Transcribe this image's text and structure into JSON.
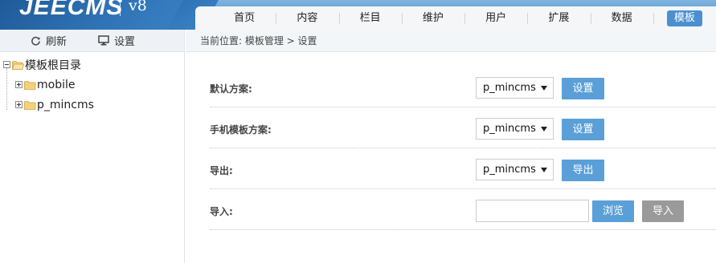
{
  "brand": {
    "name": "JEECMS",
    "version": "v8"
  },
  "nav": {
    "items": [
      {
        "label": "首页",
        "active": false
      },
      {
        "label": "内容",
        "active": false
      },
      {
        "label": "栏目",
        "active": false
      },
      {
        "label": "维护",
        "active": false
      },
      {
        "label": "用户",
        "active": false
      },
      {
        "label": "扩展",
        "active": false
      },
      {
        "label": "数据",
        "active": false
      },
      {
        "label": "模板",
        "active": true
      }
    ]
  },
  "sidebar": {
    "toolbar": {
      "refresh": "刷新",
      "settings": "设置"
    },
    "tree": {
      "root": "模板根目录",
      "children": [
        {
          "label": "mobile"
        },
        {
          "label": "p_mincms"
        }
      ]
    }
  },
  "breadcrumb": "当前位置: 模板管理 > 设置",
  "form": {
    "default_scheme": {
      "label": "默认方案:",
      "value": "p_mincms",
      "button": "设置"
    },
    "mobile_scheme": {
      "label": "手机模板方案:",
      "value": "p_mincms",
      "button": "设置"
    },
    "export": {
      "label": "导出:",
      "value": "p_mincms",
      "button": "导出"
    },
    "import": {
      "label": "导入:",
      "input_value": "",
      "browse": "浏览",
      "button": "导入"
    }
  },
  "colors": {
    "accent": "#4a8fd0",
    "button": "#5b9fd8",
    "disabled_button": "#9a9a9a",
    "header": "#5a97cf"
  }
}
